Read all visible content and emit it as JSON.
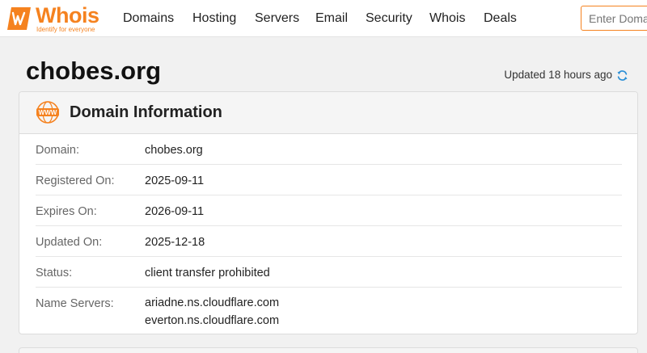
{
  "logo": {
    "word": "Whois",
    "tagline": "Identify for everyone"
  },
  "nav": {
    "items": [
      "Domains",
      "Hosting",
      "Servers",
      "Email",
      "Security",
      "Whois",
      "Deals"
    ]
  },
  "search": {
    "placeholder": "Enter Domain"
  },
  "page": {
    "title": "chobes.org",
    "updated": "Updated 18 hours ago"
  },
  "card": {
    "title": "Domain Information",
    "rows": [
      {
        "label": "Domain:",
        "value": "chobes.org"
      },
      {
        "label": "Registered On:",
        "value": "2025-09-11"
      },
      {
        "label": "Expires On:",
        "value": "2026-09-11"
      },
      {
        "label": "Updated On:",
        "value": "2025-12-18"
      },
      {
        "label": "Status:",
        "value": "client transfer prohibited"
      },
      {
        "label": "Name Servers:",
        "values": [
          "ariadne.ns.cloudflare.com",
          "everton.ns.cloudflare.com"
        ]
      }
    ]
  },
  "colors": {
    "brand": "#f5821f",
    "refresh": "#2b8fd6"
  }
}
